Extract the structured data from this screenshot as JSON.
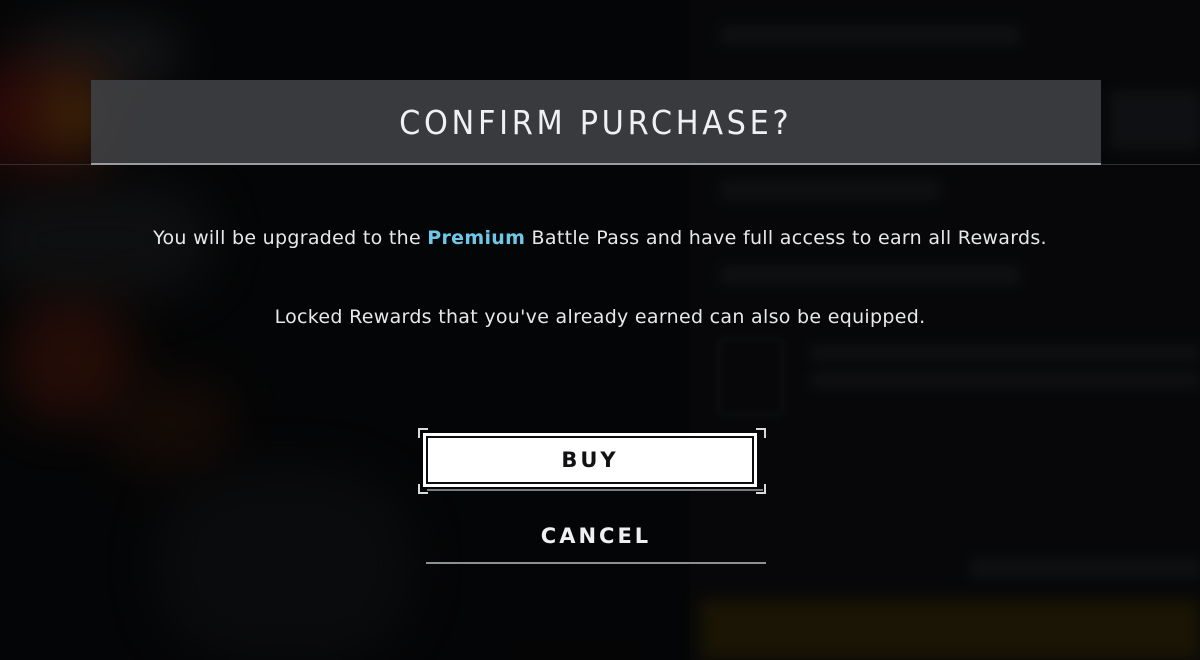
{
  "dialog": {
    "title": "CONFIRM PURCHASE?",
    "message": {
      "before": "You will be upgraded to the",
      "highlight": "Premium",
      "after": "Battle Pass and have full access to earn all Rewards."
    },
    "note": "Locked Rewards that you've already earned can also be equipped.",
    "buy_label": "BUY",
    "cancel_label": "CANCEL"
  },
  "colors": {
    "highlight": "#6fc7e8",
    "title_bar": "#3e3f42",
    "buy_button": "#ffffff"
  }
}
